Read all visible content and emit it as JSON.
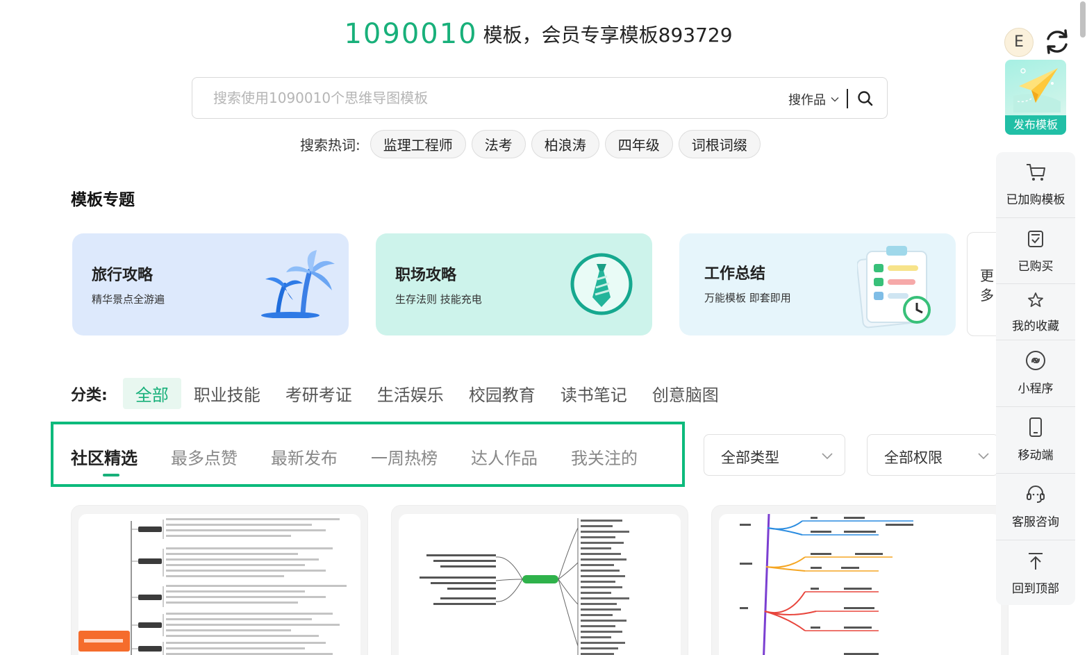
{
  "header": {
    "total_count": "1090010",
    "count_text": "模板，会员专享模板893729"
  },
  "search": {
    "placeholder": "搜索使用1090010个思维导图模板",
    "scope_label": "搜作品"
  },
  "hot_search": {
    "label": "搜索热词:",
    "tags": [
      "监理工程师",
      "法考",
      "柏浪涛",
      "四年级",
      "词根词缀"
    ]
  },
  "topics": {
    "title": "模板专题",
    "cards": [
      {
        "title": "旅行攻略",
        "subtitle": "精华景点全游遍"
      },
      {
        "title": "职场攻略",
        "subtitle": "生存法则 技能充电"
      },
      {
        "title": "工作总结",
        "subtitle": "万能模板 即套即用"
      }
    ],
    "more_label": "更多"
  },
  "categories": {
    "label": "分类:",
    "items": [
      "全部",
      "职业技能",
      "考研考证",
      "生活娱乐",
      "校园教育",
      "读书笔记",
      "创意脑图"
    ],
    "active_index": 0
  },
  "sort_tabs": {
    "items": [
      "社区精选",
      "最多点赞",
      "最新发布",
      "一周热榜",
      "达人作品",
      "我关注的"
    ],
    "active_index": 0
  },
  "filters": {
    "type_label": "全部类型",
    "permission_label": "全部权限"
  },
  "sidebar": {
    "avatar_letter": "E",
    "publish_label": "发布模板",
    "items": [
      {
        "label": "已加购模板",
        "icon": "cart-icon"
      },
      {
        "label": "已购买",
        "icon": "purchased-icon"
      },
      {
        "label": "我的收藏",
        "icon": "star-icon"
      },
      {
        "label": "小程序",
        "icon": "mini-program-icon"
      },
      {
        "label": "移动端",
        "icon": "mobile-icon"
      },
      {
        "label": "客服咨询",
        "icon": "headset-icon"
      },
      {
        "label": "回到顶部",
        "icon": "back-to-top-icon"
      }
    ]
  },
  "colors": {
    "accent": "#18b07a",
    "highlight_border": "#0dba7c",
    "publish": "#21bfa6"
  }
}
